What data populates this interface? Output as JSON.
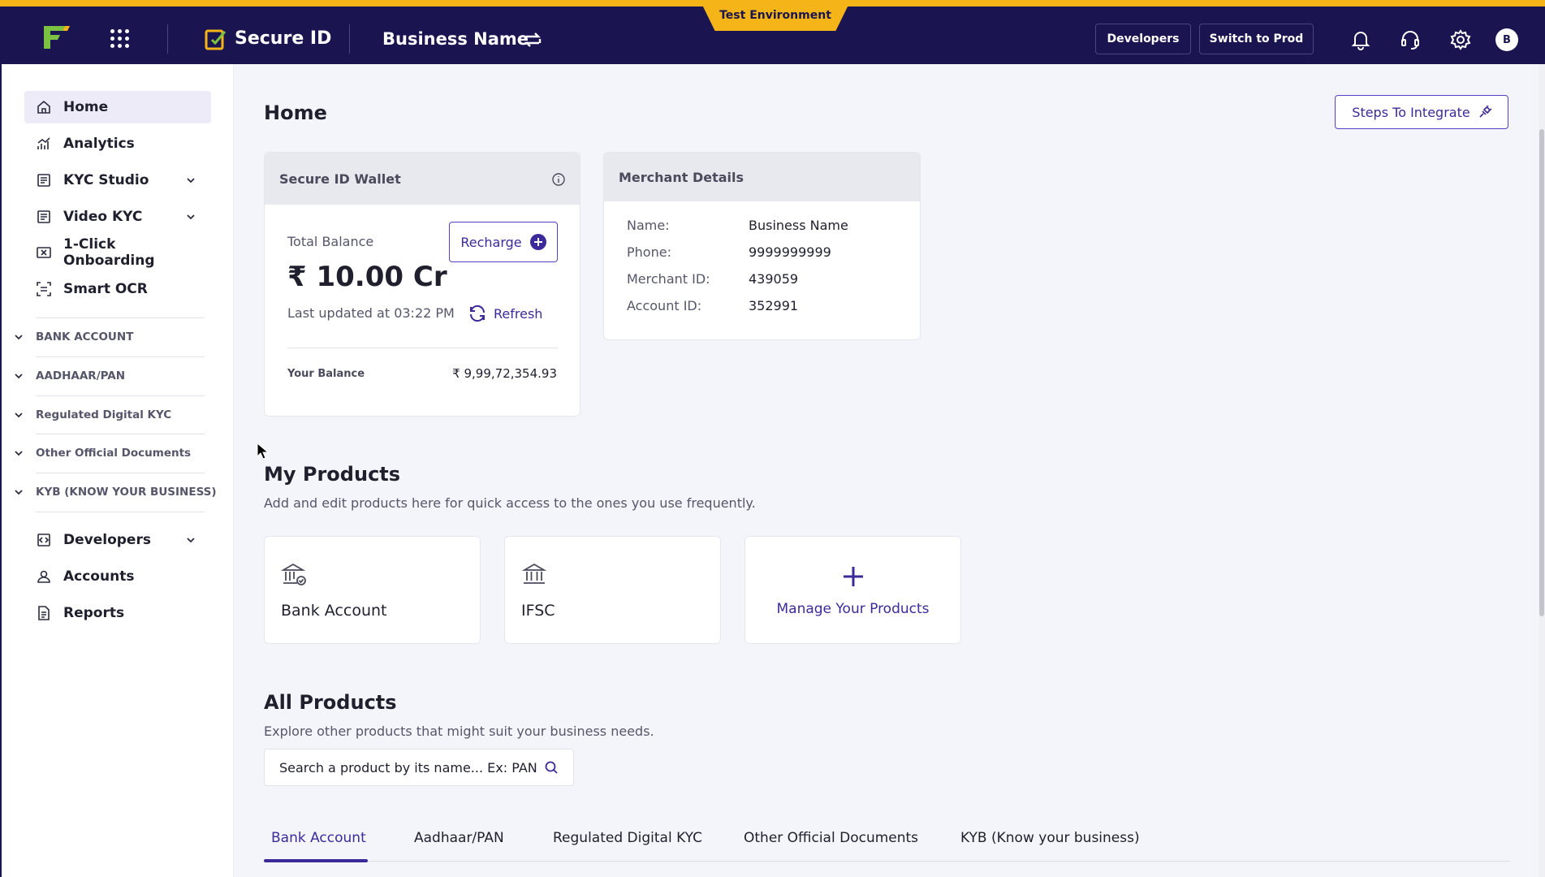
{
  "topbar": {
    "environment": "Test Environment",
    "product_name": "Secure ID",
    "business_name": "Business Name",
    "developers_label": "Developers",
    "switch_label": "Switch to Prod",
    "avatar_initial": "B",
    "accent_color": "#f5b418",
    "background_color": "#1a1550"
  },
  "sidebar": {
    "items": [
      {
        "label": "Home",
        "icon": "home-icon"
      },
      {
        "label": "Analytics",
        "icon": "analytics-icon"
      },
      {
        "label": "KYC Studio",
        "icon": "kyc-studio-icon"
      },
      {
        "label": "Video KYC",
        "icon": "video-kyc-icon"
      },
      {
        "label": "1-Click Onboarding",
        "icon": "onboarding-icon"
      },
      {
        "label": "Smart OCR",
        "icon": "scan-icon"
      }
    ],
    "groups": [
      "BANK ACCOUNT",
      "AADHAAR/PAN",
      "Regulated Digital KYC",
      "Other Official Documents",
      "KYB (KNOW YOUR BUSINESS)"
    ],
    "bottom_items": [
      {
        "label": "Developers",
        "icon": "code-icon"
      },
      {
        "label": "Accounts",
        "icon": "user-icon"
      },
      {
        "label": "Reports",
        "icon": "report-icon"
      }
    ]
  },
  "main": {
    "title": "Home",
    "steps_button": "Steps To Integrate",
    "wallet": {
      "title": "Secure ID Wallet",
      "total_label": "Total Balance",
      "total_amount": "₹ 10.00 Cr",
      "recharge_label": "Recharge",
      "updated": "Last updated at 03:22 PM",
      "refresh_label": "Refresh",
      "your_balance_label": "Your Balance",
      "your_balance_value": "₹ 9,99,72,354.93"
    },
    "merchant": {
      "title": "Merchant Details",
      "rows": [
        {
          "key": "Name:",
          "value": "Business Name"
        },
        {
          "key": "Phone:",
          "value": "9999999999"
        },
        {
          "key": "Merchant ID:",
          "value": "439059"
        },
        {
          "key": "Account ID:",
          "value": "352991"
        }
      ]
    },
    "my_products": {
      "title": "My Products",
      "subtitle": "Add and edit products here for quick access to the ones you use frequently.",
      "items": [
        "Bank Account",
        "IFSC"
      ],
      "manage_label": "Manage Your Products"
    },
    "all_products": {
      "title": "All Products",
      "subtitle": "Explore other products that might suit your business needs.",
      "search_placeholder": "Search a product by its name... Ex: PAN",
      "tabs": [
        "Bank Account",
        "Aadhaar/PAN",
        "Regulated Digital KYC",
        "Other Official Documents",
        "KYB (Know your business)"
      ],
      "active_tab": "Bank Account"
    }
  }
}
